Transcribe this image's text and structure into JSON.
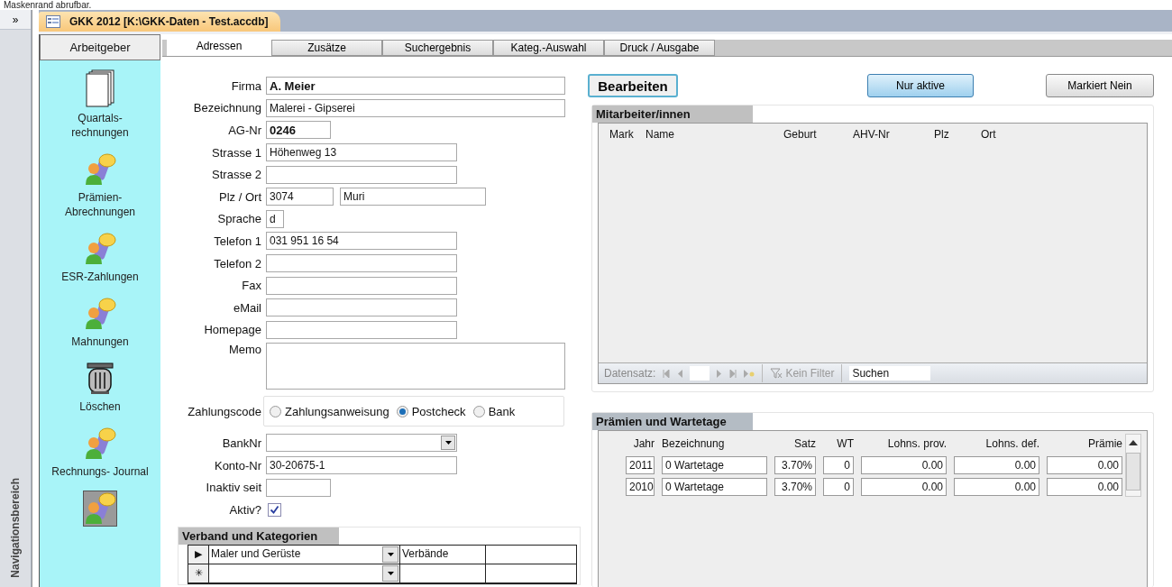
{
  "top_caption": "Maskenrand abrufbar.",
  "nav_pane": {
    "toggle": "»",
    "label": "Navigationsbereich"
  },
  "document_tab": {
    "title": "GKK 2012 [K:\\GKK-Daten - Test.accdb]"
  },
  "sidebar": {
    "title": "Arbeitgeber",
    "items": [
      {
        "kind": "pages",
        "label": "Quartals-\nrechnungen",
        "selected": false
      },
      {
        "kind": "people",
        "label": "Prämien-\nAbrechnungen",
        "selected": false
      },
      {
        "kind": "people",
        "label": "ESR-Zahlungen",
        "selected": false
      },
      {
        "kind": "people",
        "label": "Mahnungen",
        "selected": false
      },
      {
        "kind": "trash",
        "label": "Löschen",
        "selected": false
      },
      {
        "kind": "people",
        "label": "Rechnungs- Journal",
        "selected": false
      },
      {
        "kind": "people",
        "selected": true
      }
    ]
  },
  "tabs": [
    {
      "label": "Adressen",
      "selected": true
    },
    {
      "label": "Zusätze",
      "selected": false
    },
    {
      "label": "Suchergebnis",
      "selected": false
    },
    {
      "label": "Kateg.-Auswahl",
      "selected": false
    },
    {
      "label": "Druck / Ausgabe",
      "selected": false
    }
  ],
  "form": {
    "fields": [
      {
        "kind": "wide",
        "label": "Firma",
        "value": "A. Meier",
        "bold": true
      },
      {
        "kind": "wide",
        "label": "Bezeichnung",
        "value": "Malerei - Gipserei",
        "bold": false
      },
      {
        "kind": "short",
        "label": "AG-Nr",
        "value": "0246",
        "bold": true
      },
      {
        "kind": "medium",
        "label": "Strasse 1",
        "value": "Höhenweg 13",
        "bold": false
      },
      {
        "kind": "medium",
        "label": "Strasse 2"
      },
      {
        "kind": "pair",
        "label": "Plz /  Ort",
        "value": "3074",
        "value_2": "Muri",
        "bold": false
      },
      {
        "kind": "tiny",
        "label": "Sprache",
        "value": "d",
        "bold": false
      },
      {
        "kind": "medium",
        "label": "Telefon 1",
        "value": "031 951 16 54",
        "bold": false
      },
      {
        "kind": "medium",
        "label": "Telefon 2"
      },
      {
        "kind": "medium",
        "label": "Fax"
      },
      {
        "kind": "medium",
        "label": "eMail"
      },
      {
        "kind": "medium",
        "label": "Homepage"
      },
      {
        "kind": "memo",
        "label": "Memo"
      },
      {
        "kind": "radio",
        "label": "Zahlungscode",
        "options": [
          {
            "label": "Zahlungsanweisung",
            "selected": false
          },
          {
            "label": "Postcheck",
            "selected": true
          },
          {
            "label": "Bank",
            "selected": false
          }
        ]
      },
      {
        "kind": "combo",
        "label": "BankNr"
      },
      {
        "kind": "medium",
        "label": "Konto-Nr",
        "value": "30-20675-1",
        "bold": false
      },
      {
        "kind": "short",
        "label": "Inaktiv seit"
      },
      {
        "kind": "checkbox",
        "label": "Aktiv?",
        "checked": true
      }
    ]
  },
  "verband": {
    "title": "Verband und Kategorien",
    "rows": [
      {
        "selector": "▶",
        "category": "Maler und Gerüste",
        "type": "Verbände"
      },
      {
        "selector": "✳"
      }
    ]
  },
  "buttons": [
    {
      "kind": "bold",
      "label": "Bearbeiten"
    },
    {
      "kind": "primary",
      "label": "Nur aktive"
    },
    {
      "kind": "plain",
      "label": "Markiert Nein"
    }
  ],
  "employees": {
    "title": "Mitarbeiter/innen",
    "columns": [
      "Mark",
      "Name",
      "Geburt",
      "AHV-Nr",
      "Plz",
      "Ort"
    ],
    "navigator": {
      "label": "Datensatz:",
      "filter": "Kein Filter",
      "search_placeholder": "Suchen"
    }
  },
  "premiums": {
    "title": "Prämien und Wartetage",
    "columns": [
      "Jahr",
      "Bezeichnung",
      "Satz",
      "WT",
      "Lohns. prov.",
      "Lohns. def.",
      "Prämie"
    ],
    "rows": [
      {
        "year": "2011",
        "name": "0 Wartetage",
        "rate": "3.70%",
        "wt": "0",
        "prov": "0.00",
        "def": "0.00",
        "premium": "0.00"
      },
      {
        "year": "2010",
        "name": "0 Wartetage",
        "rate": "3.70%",
        "wt": "0",
        "prov": "0.00",
        "def": "0.00",
        "premium": "0.00"
      }
    ]
  }
}
